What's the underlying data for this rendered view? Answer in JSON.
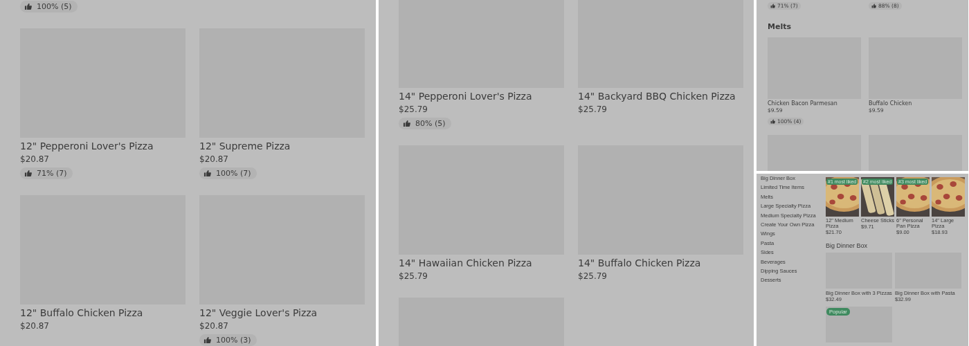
{
  "panels": [
    {
      "blocks": [
        {
          "kind": "ratings",
          "cells": [
            {
              "rating": "100% (5)"
            }
          ]
        },
        {
          "kind": "cards",
          "cards": [
            {
              "kind": "placeholder",
              "title": "12\" Pepperoni Lover's Pizza",
              "price": "$20.87",
              "rating": "71% (7)"
            },
            {
              "kind": "placeholder",
              "title": "12\" Supreme Pizza",
              "price": "$20.87",
              "rating": "100% (7)"
            }
          ]
        },
        {
          "kind": "cards",
          "cards": [
            {
              "kind": "placeholder",
              "title": "12\" Buffalo Chicken Pizza",
              "price": "$20.87"
            },
            {
              "kind": "placeholder",
              "title": "12\" Veggie Lover's Pizza",
              "price": "$20.87",
              "rating": "100% (3)"
            }
          ]
        }
      ]
    },
    {
      "blocks": [
        {
          "kind": "cards",
          "cards": [
            {
              "kind": "placeholder",
              "title": "14\" Pepperoni Lover's Pizza",
              "price": "$25.79",
              "rating": "80% (5)"
            },
            {
              "kind": "placeholder",
              "title": "14\" Backyard BBQ Chicken Pizza",
              "price": "$25.79"
            }
          ]
        },
        {
          "kind": "cards",
          "cards": [
            {
              "kind": "placeholder",
              "title": "14\" Hawaiian Chicken Pizza",
              "price": "$25.79"
            },
            {
              "kind": "placeholder",
              "title": "14\" Buffalo Chicken Pizza",
              "price": "$25.79"
            }
          ]
        },
        {
          "kind": "cards",
          "cards": [
            {
              "kind": "placeholder"
            }
          ]
        }
      ]
    },
    {
      "blocks": [
        {
          "kind": "ratings",
          "cells": [
            {
              "rating": "71% (7)"
            },
            {
              "rating": "88% (8)"
            }
          ]
        },
        {
          "kind": "heading",
          "text": "Melts"
        },
        {
          "kind": "cards",
          "cards": [
            {
              "kind": "placeholder",
              "title": "Chicken Bacon Parmesan",
              "price": "$9.59",
              "rating": "100% (4)"
            },
            {
              "kind": "placeholder",
              "title": "Buffalo Chicken",
              "price": "$9.59"
            }
          ]
        },
        {
          "kind": "cards",
          "cards": [
            {
              "kind": "placeholder"
            },
            {
              "kind": "placeholder"
            }
          ]
        }
      ]
    },
    {
      "sidebar": {
        "items": [
          "Big Dinner Box",
          "Limited Time Items",
          "Melts",
          "Large Specialty Pizza",
          "Medium Specialty Pizza",
          "Create Your Own Pizza",
          "Wings",
          "Pasta",
          "Sides",
          "Beverages",
          "Dipping Sauces",
          "Desserts"
        ]
      },
      "blocks": [
        {
          "kind": "carousel",
          "cards": [
            {
              "badge": "#1 most liked",
              "title": "12\" Medium Pizza",
              "price": "$21.70"
            },
            {
              "badge": "#2 most liked",
              "title": "Cheese Sticks",
              "price": "$9.71"
            },
            {
              "badge": "#3 most liked",
              "title": "6\" Personal Pan Pizza",
              "price": "$9.00"
            },
            {
              "title": "14\" Large Pizza",
              "price": "$18.93"
            }
          ]
        },
        {
          "kind": "heading",
          "text": "Big Dinner Box"
        },
        {
          "kind": "cards",
          "cards": [
            {
              "kind": "placeholder",
              "title": "Big Dinner Box with 3 Pizzas",
              "price": "$32.49"
            },
            {
              "kind": "placeholder",
              "title": "Big Dinner Box with Pasta",
              "price": "$32.99"
            }
          ]
        },
        {
          "kind": "cards",
          "cards": [
            {
              "kind": "placeholder",
              "badge": "Popular"
            }
          ]
        }
      ]
    }
  ]
}
